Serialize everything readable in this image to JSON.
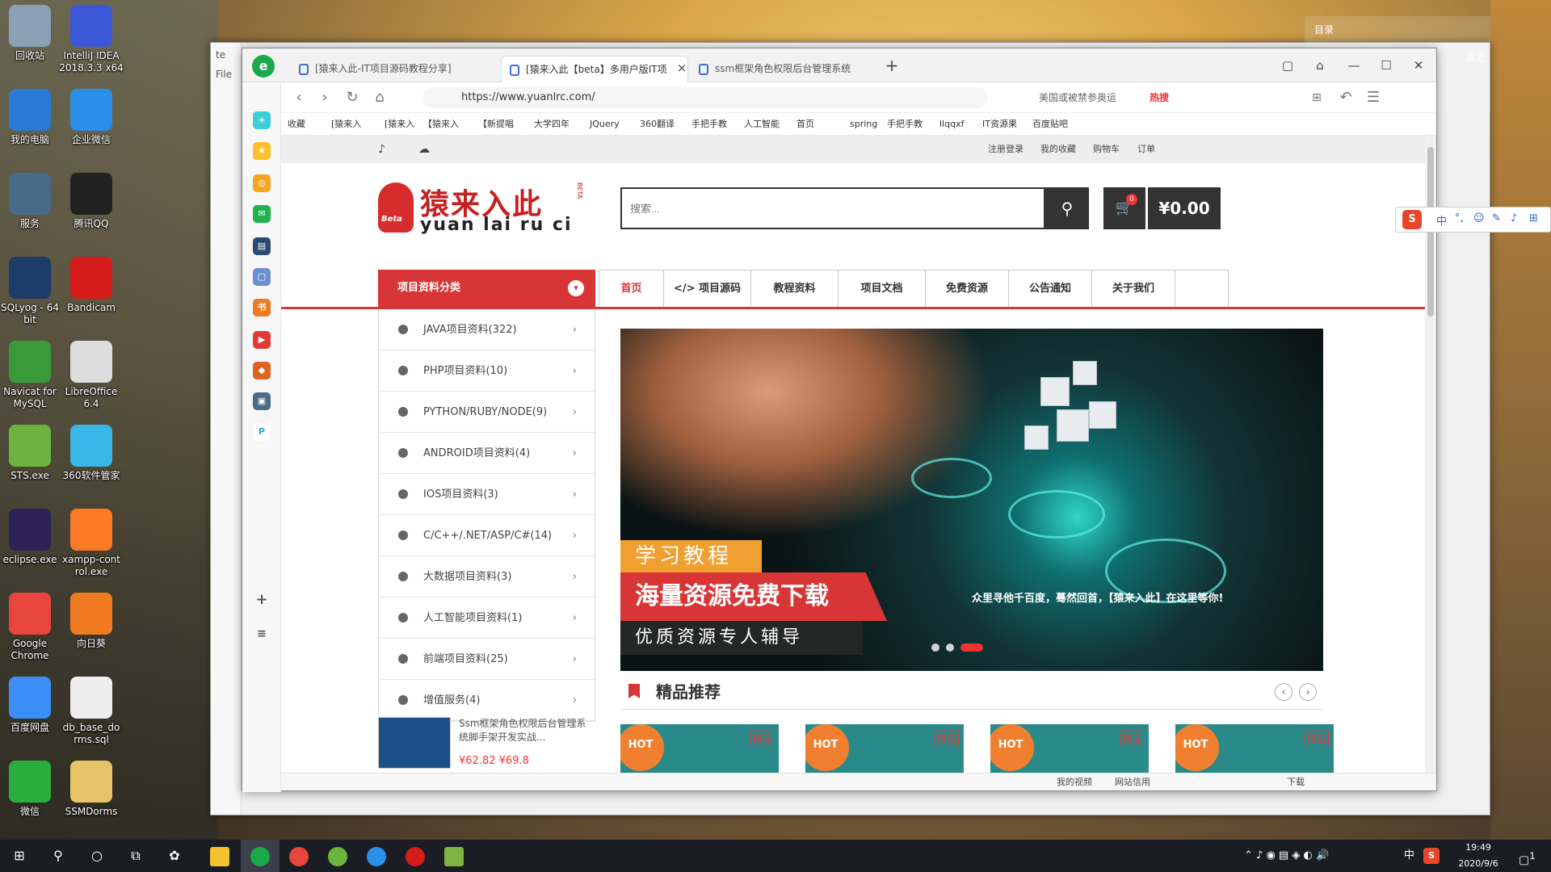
{
  "desktop": {
    "icons": [
      {
        "label": "回收站",
        "icon": "recycle-bin-icon",
        "color": "#8aa0b5"
      },
      {
        "label": "IntelliJ IDEA 2018.3.3 x64",
        "icon": "intellij-icon",
        "color": "#3d58d6"
      },
      {
        "label": "我的电脑",
        "icon": "computer-icon",
        "color": "#2a7ad4"
      },
      {
        "label": "企业微信",
        "icon": "wecom-icon",
        "color": "#2b8fe8"
      },
      {
        "label": "服务",
        "icon": "gear-icon",
        "color": "#4a6a8a"
      },
      {
        "label": "腾讯QQ",
        "icon": "qq-icon",
        "color": "#222"
      },
      {
        "label": "SQLyog - 64 bit",
        "icon": "sqlyog-icon",
        "color": "#1d3c6a"
      },
      {
        "label": "Bandicam",
        "icon": "record-icon",
        "color": "#d61b1b"
      },
      {
        "label": "Navicat for MySQL",
        "icon": "navicat-icon",
        "color": "#3a9a3a"
      },
      {
        "label": "LibreOffice 6.4",
        "icon": "document-icon",
        "color": "#ddd"
      },
      {
        "label": "STS.exe",
        "icon": "spring-icon",
        "color": "#6db33f"
      },
      {
        "label": "360软件管家",
        "icon": "360-icon",
        "color": "#38b6e8"
      },
      {
        "label": "eclipse.exe",
        "icon": "eclipse-icon",
        "color": "#2c2255"
      },
      {
        "label": "xampp-cont rol.exe",
        "icon": "xampp-icon",
        "color": "#fb7a24"
      },
      {
        "label": "Google Chrome",
        "icon": "chrome-icon",
        "color": "#e8453c"
      },
      {
        "label": "向日葵",
        "icon": "sunflower-icon",
        "color": "#f07a20"
      },
      {
        "label": "百度网盘",
        "icon": "baidu-pan-icon",
        "color": "#3a8ef6"
      },
      {
        "label": "db_base_do rms.sql",
        "icon": "file-icon",
        "color": "#eee"
      },
      {
        "label": "微信",
        "icon": "wechat-icon",
        "color": "#2aae3e"
      },
      {
        "label": "SSMDorms",
        "icon": "folder-icon",
        "color": "#e8c36a"
      }
    ]
  },
  "backwin": {
    "label1": "te",
    "label2": "File",
    "right": {
      "a": "目录",
      "b": "其它"
    }
  },
  "browser": {
    "tabs": [
      {
        "title": "[猿来入此-IT项目源码教程分享]"
      },
      {
        "title": "[猿来入此【beta】多用户版IT项"
      },
      {
        "title": "ssm框架角色权限后台管理系统"
      }
    ],
    "url": "https://www.yuanlrc.com/",
    "search_hint": "美国或被禁参奥运",
    "hot_label": "热搜",
    "bookmarks": [
      "收藏",
      "[猿来入",
      "[猿来入",
      "【猿来入",
      "【新提唱",
      "大学四年",
      "JQuery",
      "360翻译",
      "手把手教",
      "人工智能",
      "首页",
      "spring",
      "手把手教",
      "llqqxf",
      "IT资源果",
      "百度贴吧"
    ],
    "status": {
      "video": "我的视频",
      "net": "网站信用",
      "download": "下载"
    }
  },
  "page": {
    "toplinks": [
      "注册登录",
      "我的收藏",
      "购物车",
      "订单"
    ],
    "logo": {
      "cn": "猿来入此",
      "en": "yuan lai ru ci",
      "beta": "Beta",
      "tag": "BETA"
    },
    "search": {
      "placeholder": "搜索..."
    },
    "cart": {
      "count": "0",
      "total": "¥0.00"
    },
    "category_title": "项目资料分类",
    "nav": [
      "首页",
      "</> 项目源码",
      "教程资料",
      "项目文档",
      "免费资源",
      "公告通知",
      "关于我们"
    ],
    "categories": [
      "JAVA项目资料(322)",
      "PHP项目资料(10)",
      "PYTHON/RUBY/NODE(9)",
      "ANDROID项目资料(4)",
      "IOS项目资料(3)",
      "C/C++/.NET/ASP/C#(14)",
      "大数据项目资料(3)",
      "人工智能项目资料(1)",
      "前端项目资料(25)",
      "增值服务(4)"
    ],
    "banner": {
      "t1": "学习教程",
      "t2": "海量资源免费下载",
      "t3": "优质资源专人辅导",
      "t4": "众里寻他千百度，蓦然回首，【猿来入此】在这里等你!"
    },
    "recommend_title": "精品推荐",
    "product": {
      "name": "Ssm框架角色权限后台管理系统脚手架开发实战...",
      "price": "¥62.82  ¥69.8"
    },
    "cards": [
      {
        "hot": "HOT",
        "tag": "精选"
      },
      {
        "hot": "HOT",
        "tag": "精选"
      },
      {
        "hot": "HOT",
        "tag": "精选"
      },
      {
        "hot": "HOT",
        "tag": "精选"
      }
    ]
  },
  "taskbar": {
    "time": "19:49",
    "date": "2020/9/6",
    "ime": "中",
    "badge": "1"
  },
  "ime_bar": {
    "items": [
      "中",
      "°,",
      "☺",
      "✎",
      "♪",
      "⊞"
    ]
  }
}
